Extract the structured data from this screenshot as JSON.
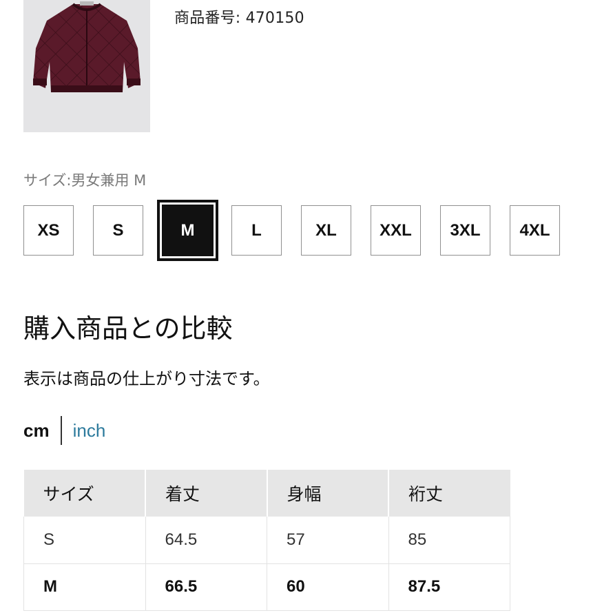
{
  "product": {
    "code_text": "商品番号: 470150",
    "image_icon": "quilted-bomber-jacket-image",
    "image_color": "#5a1a2a"
  },
  "size_selector": {
    "label": "サイズ:男女兼用 M",
    "options": [
      "XS",
      "S",
      "M",
      "L",
      "XL",
      "XXL",
      "3XL",
      "4XL"
    ],
    "selected": "M"
  },
  "comparison": {
    "title": "購入商品との比較",
    "note": "表示は商品の仕上がり寸法です。",
    "units": {
      "active": "cm",
      "inactive": "inch",
      "inactive_color": "#2c7a9c"
    },
    "table": {
      "headers": [
        "サイズ",
        "着丈",
        "身幅",
        "裄丈"
      ],
      "rows": [
        [
          "S",
          "64.5",
          "57",
          "85"
        ],
        [
          "M",
          "66.5",
          "60",
          "87.5"
        ]
      ],
      "highlighted_row": "M"
    }
  }
}
